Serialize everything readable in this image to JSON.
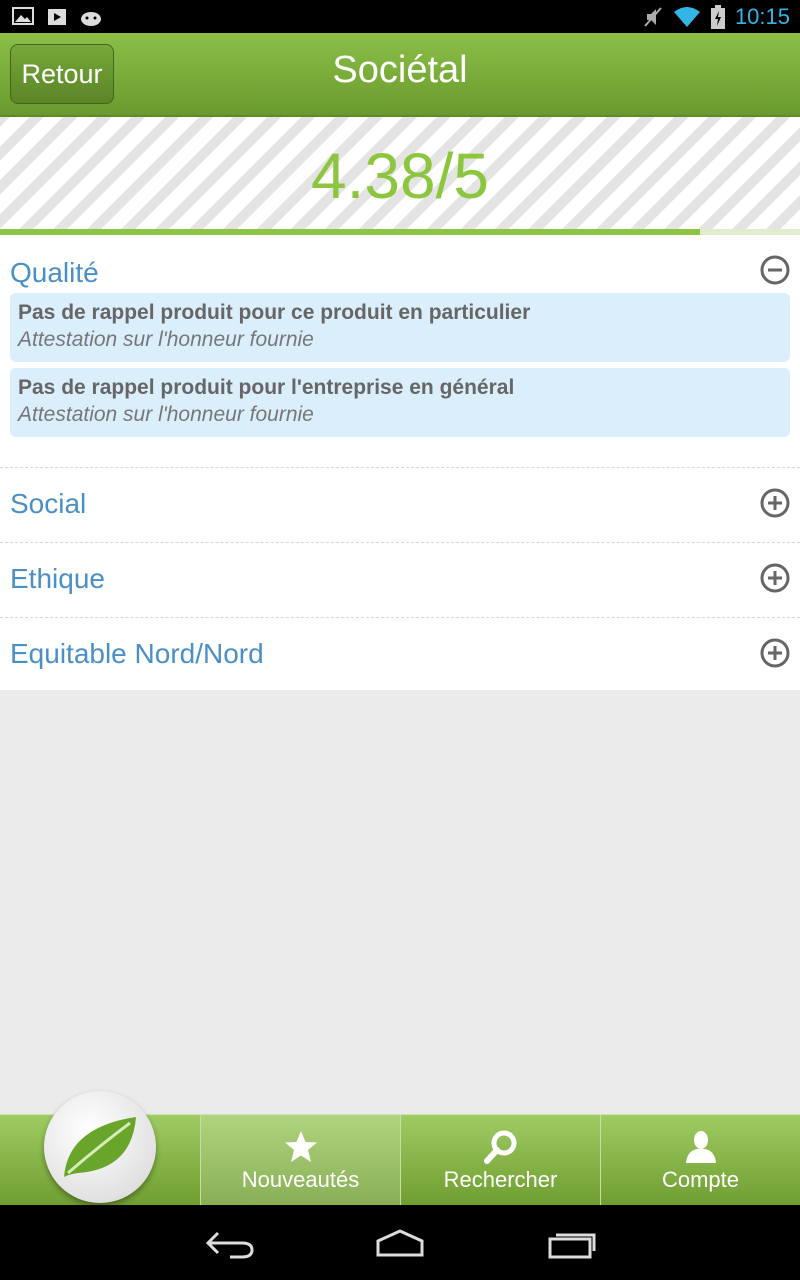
{
  "status_bar": {
    "time": "10:15",
    "left_icons": [
      "image-icon",
      "play-store-icon",
      "android-icon"
    ],
    "right_icons": [
      "mute-icon",
      "wifi-icon",
      "battery-icon"
    ]
  },
  "action_bar": {
    "back_label": "Retour",
    "title": "Sociétal"
  },
  "score": {
    "text": "4.38/5",
    "progress_fraction": 0.875,
    "color": "#8cc63f"
  },
  "sections": [
    {
      "title": "Qualité",
      "expanded": true,
      "items": [
        {
          "title": "Pas de rappel produit pour ce produit en particulier",
          "subtitle": "Attestation sur l'honneur fournie"
        },
        {
          "title": "Pas de rappel produit pour l'entreprise en général",
          "subtitle": "Attestation sur l'honneur fournie"
        }
      ]
    },
    {
      "title": "Social",
      "expanded": false
    },
    {
      "title": "Ethique",
      "expanded": false
    },
    {
      "title": "Equitable Nord/Nord",
      "expanded": false
    }
  ],
  "tab_bar": {
    "logo_icon": "leaf-icon",
    "tabs": [
      {
        "label": "Nouveautés",
        "icon": "star-icon",
        "active": true
      },
      {
        "label": "Rechercher",
        "icon": "search-icon",
        "active": false
      },
      {
        "label": "Compte",
        "icon": "person-icon",
        "active": false
      }
    ]
  },
  "nav_bar": [
    "back-icon",
    "home-icon",
    "recents-icon"
  ],
  "colors": {
    "accent_green": "#8cc63f",
    "section_blue": "#4a90c8",
    "item_background": "#daeefb"
  }
}
